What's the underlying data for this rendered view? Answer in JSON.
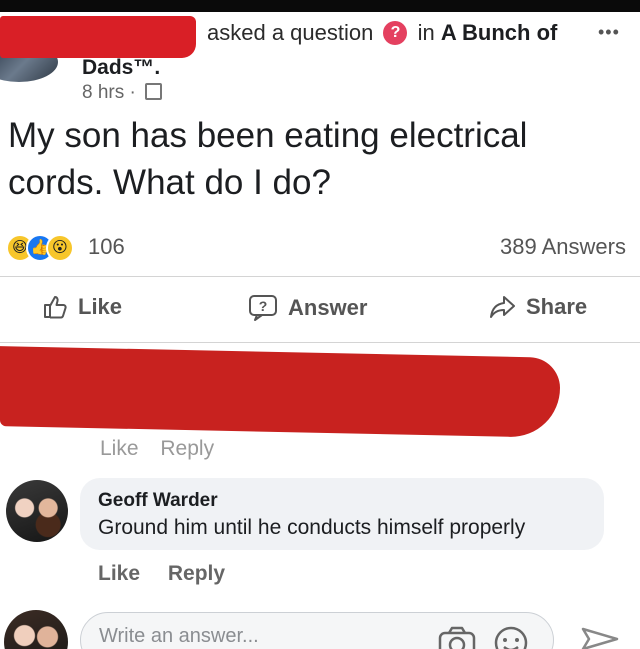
{
  "post": {
    "asked_text": "asked a question",
    "question_badge": "?",
    "in_text": "in",
    "group_name_part1": "A Bunch of",
    "group_name_part2": "Dads™.",
    "time": "8 hrs ·",
    "more_label": "•••",
    "question": "My son has been eating electrical cords. What do I do?"
  },
  "stats": {
    "reactions": [
      "haha-icon",
      "like-icon",
      "wow-icon"
    ],
    "reaction_count": "106",
    "answers": "389 Answers"
  },
  "actions": {
    "like": "Like",
    "answer": "Answer",
    "share": "Share"
  },
  "redacted_comment": {
    "like": "Like",
    "reply": "Reply"
  },
  "comment": {
    "author": "Geoff Warder",
    "text": "Ground him until he conducts himself properly",
    "like": "Like",
    "reply": "Reply"
  },
  "composer": {
    "placeholder": "Write an answer..."
  },
  "colors": {
    "redaction": "#d91f26",
    "question_badge": "#e4405f",
    "like_blue": "#1877f2",
    "bubble_bg": "#f0f2f5"
  }
}
